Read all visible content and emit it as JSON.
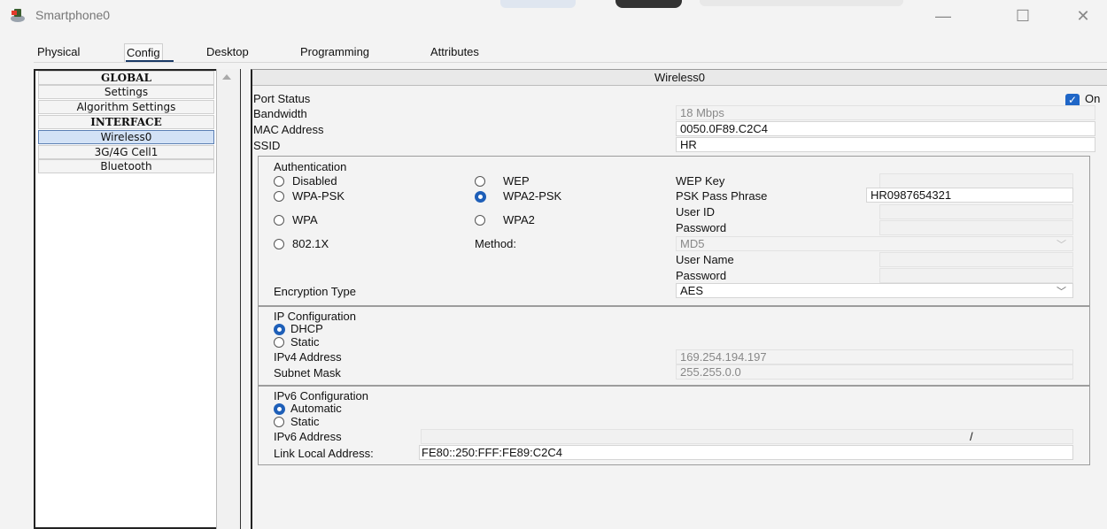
{
  "window": {
    "title": "Smartphone0",
    "minimize_glyph": "—",
    "maximize_glyph": "☐",
    "close_glyph": "✕"
  },
  "tabs": [
    {
      "label": "Physical"
    },
    {
      "label": "Config"
    },
    {
      "label": "Desktop"
    },
    {
      "label": "Programming"
    },
    {
      "label": "Attributes"
    }
  ],
  "sidebar": {
    "items": [
      {
        "label": "GLOBAL"
      },
      {
        "label": "Settings"
      },
      {
        "label": "Algorithm Settings"
      },
      {
        "label": "INTERFACE"
      },
      {
        "label": "Wireless0"
      },
      {
        "label": "3G/4G Cell1"
      },
      {
        "label": "Bluetooth"
      }
    ]
  },
  "panel": {
    "header": "Wireless0",
    "port_status_label": "Port Status",
    "port_status_value": "On",
    "bandwidth_label": "Bandwidth",
    "bandwidth_value": "18 Mbps",
    "mac_label": "MAC Address",
    "mac_value": "0050.0F89.C2C4",
    "ssid_label": "SSID",
    "ssid_value": "HR"
  },
  "auth": {
    "title": "Authentication",
    "disabled": "Disabled",
    "wep": "WEP",
    "wpa_psk": "WPA-PSK",
    "wpa2_psk": "WPA2-PSK",
    "wpa": "WPA",
    "wpa2": "WPA2",
    "dot1x": "802.1X",
    "method_label": "Method:",
    "wep_key_label": "WEP Key",
    "psk_label": "PSK Pass Phrase",
    "psk_value": "HR0987654321",
    "user_id_label": "User ID",
    "password_label": "Password",
    "method_value": "MD5",
    "user_name_label": "User Name",
    "password2_label": "Password",
    "encryption_label": "Encryption Type",
    "encryption_value": "AES"
  },
  "ip": {
    "title": "IP Configuration",
    "dhcp": "DHCP",
    "static": "Static",
    "ipv4_label": "IPv4 Address",
    "ipv4_value": "169.254.194.197",
    "mask_label": "Subnet Mask",
    "mask_value": "255.255.0.0"
  },
  "ipv6": {
    "title": "IPv6 Configuration",
    "automatic": "Automatic",
    "static": "Static",
    "address_label": "IPv6 Address",
    "prefix_sep": "/",
    "link_local_label": "Link Local Address:",
    "link_local_value": "FE80::250:FFF:FE89:C2C4"
  },
  "colors": {
    "accent": "#1e5fb8",
    "selected_item": "#d3e2f6"
  }
}
